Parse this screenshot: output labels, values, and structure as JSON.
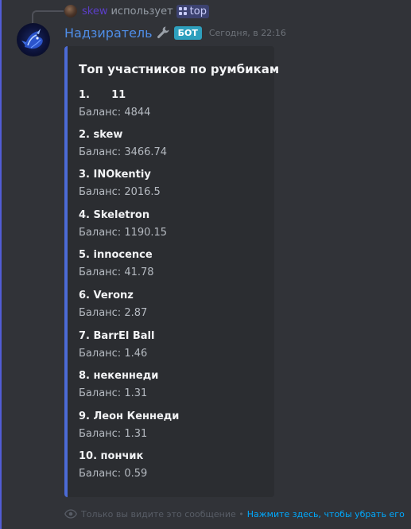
{
  "reply": {
    "username": "skew",
    "action_text": "использует",
    "command": "top"
  },
  "message": {
    "author": "Надзиратель",
    "badge": "БОТ",
    "timestamp": "Сегодня, в 22:16"
  },
  "embed": {
    "title": "Топ участников по румбикам",
    "accent_color": "#4c6bd6",
    "entries": [
      {
        "name": "1.      11",
        "balance": "Баланс: 4844"
      },
      {
        "name": "2. skew",
        "balance": "Баланс: 3466.74"
      },
      {
        "name": "3. INOkentiy",
        "balance": "Баланс: 2016.5"
      },
      {
        "name": "4. Skeletron",
        "balance": "Баланс: 1190.15"
      },
      {
        "name": "5. innocence",
        "balance": "Баланс: 41.78"
      },
      {
        "name": "6. Veronz",
        "balance": "Баланс: 2.87"
      },
      {
        "name": "7. BarrEl Ball",
        "balance": "Баланс: 1.46"
      },
      {
        "name": "8. некеннеди",
        "balance": "Баланс: 1.31"
      },
      {
        "name": "9. Леон Кеннеди",
        "balance": "Баланс: 1.31"
      },
      {
        "name": "10. пончик",
        "balance": "Баланс: 0.59"
      }
    ]
  },
  "footer": {
    "note": "Только вы видите это сообщение •",
    "dismiss_link": "Нажмите здесь, чтобы убрать его"
  },
  "icons": {
    "reply_avatar": "user-avatar",
    "command": "slash-command-icon",
    "bot_avatar": "dragon-avatar",
    "wrench": "wrench-icon",
    "eye": "eye-icon"
  },
  "colors": {
    "background": "#313338",
    "embed_background": "#2b2d31",
    "author_name": "#4f8ee8",
    "bot_badge": "#2e9fbd",
    "link": "#00a8fc",
    "reply_username": "#5c3ec9"
  }
}
